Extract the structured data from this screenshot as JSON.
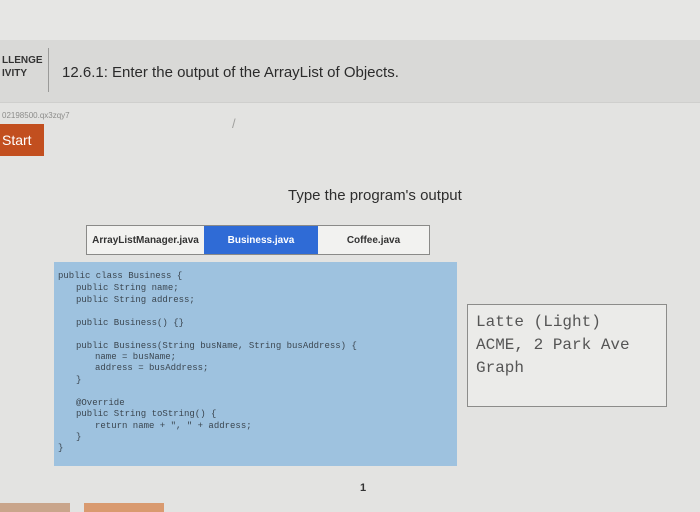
{
  "header": {
    "challenge_label": "LLENGE",
    "activity_label": "IVITY",
    "title": "12.6.1: Enter the output of the ArrayList of Objects.",
    "activity_id": "02198500.qx3zqy7",
    "cursor_mark": "/"
  },
  "start_label": "Start",
  "instruction": "Type the program's output",
  "tabs": [
    {
      "label": "ArrayListManager.java"
    },
    {
      "label": "Business.java"
    },
    {
      "label": "Coffee.java"
    }
  ],
  "active_tab": "Business.java",
  "code": {
    "l1": "public class Business {",
    "l2": "public String name;",
    "l3": "public String address;",
    "l4": "public Business() {}",
    "l5": "public Business(String busName, String busAddress) {",
    "l6": "name = busName;",
    "l7": "address = busAddress;",
    "l8": "}",
    "l9": "@Override",
    "l10": "public String toString() {",
    "l11": "return name + \", \" + address;",
    "l12": "}",
    "l13": "}"
  },
  "output_lines": [
    "Latte (Light)",
    "ACME, 2 Park Ave",
    "Graph"
  ],
  "page_number": "1",
  "colors": {
    "start_button": "#c24f1f",
    "active_tab": "#2f6bd6",
    "code_background": "#9ec2df"
  }
}
